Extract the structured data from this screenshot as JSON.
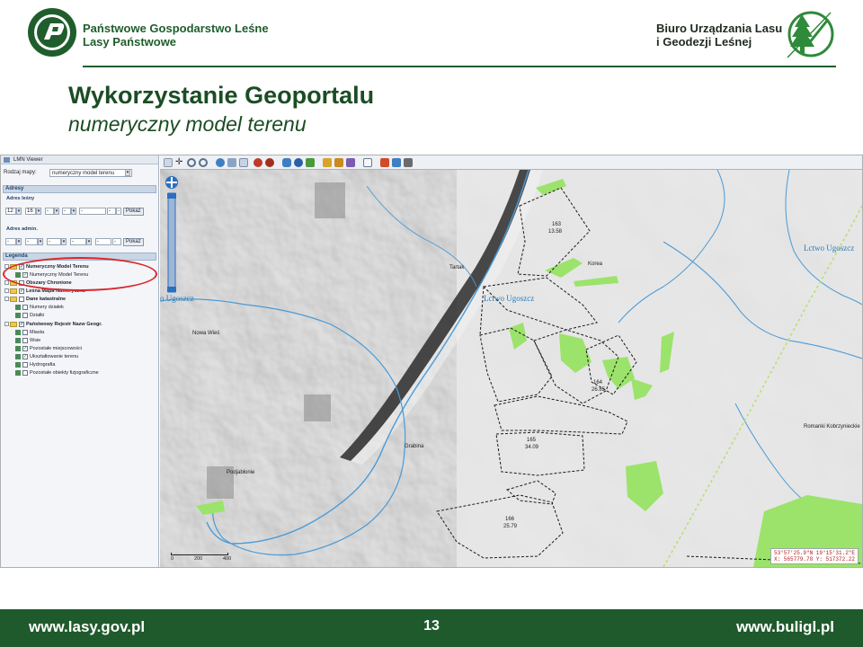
{
  "header": {
    "org_line1": "Państwowe Gospodarstwo Leśne",
    "org_line2": "Lasy Państwowe",
    "biuro_line1": "Biuro Urządzania Lasu",
    "biuro_line2": "i Geodezji Leśnej",
    "logo_left_text": "LASY PAŃSTWOWE"
  },
  "slide": {
    "title": "Wykorzystanie Geoportalu",
    "subtitle": "numeryczny model terenu"
  },
  "viewer": {
    "window_title": "LMN Viewer",
    "map_type_label": "Rodzaj mapy:",
    "map_type_value": "numeryczny model terenu",
    "section_adresy": "Adresy",
    "adres_lesny_label": "Adres leśny",
    "adres_lesny_values": [
      "12",
      "16",
      "-",
      "-",
      "-",
      "-",
      "-"
    ],
    "adres_admin_label": "Adres admin.",
    "admin_values": [
      "-",
      "-",
      "-",
      "-",
      "-",
      "-"
    ],
    "show_button": "Pokaż",
    "section_legenda": "Legenda",
    "legend_items": [
      {
        "label": "Numeryczny Model Terenu",
        "bold": true
      },
      {
        "label": "Numeryczny Model Terenu",
        "bold": false
      },
      {
        "label": "Obszary Chronione",
        "bold": true
      },
      {
        "label": "Leśna Mapa Numeryczna",
        "bold": true
      },
      {
        "label": "Dane katastralne",
        "bold": true
      },
      {
        "label": "Numery działek",
        "bold": false
      },
      {
        "label": "Działki",
        "bold": false
      },
      {
        "label": "Państwowy Rejestr Nazw Geogr.",
        "bold": true
      },
      {
        "label": "Miasta",
        "bold": false
      },
      {
        "label": "Wsie",
        "bold": false
      },
      {
        "label": "Pozostałe miejscowości",
        "bold": false
      },
      {
        "label": "Ukształtowanie terenu",
        "bold": false
      },
      {
        "label": "Hydrografia",
        "bold": false
      },
      {
        "label": "Pozostałe obiekty fizjograficzne",
        "bold": false
      }
    ]
  },
  "map": {
    "labels": {
      "tartak": "Tartak",
      "nowa_wies": "Nowa Wieś",
      "grabina": "Grabina",
      "podjablonie": "Podjabłonie",
      "korea": "Korea",
      "romanki": "Romanki Kobrzyniec­kie",
      "gosz1": "Lctwo Ugoszcz",
      "gosz2": "Lctwo Ugoszcz",
      "gosz3": "o Ugoszcz"
    },
    "compartments": {
      "c163": "163",
      "c163a": "13.58",
      "c164": "164",
      "c164a": "26.85",
      "c165": "165",
      "c165a": "34.09",
      "c166": "166",
      "c166a": "25.79"
    },
    "coords_line1": "53°57'25.9\"N 19°15'31.2\"E",
    "coords_line2": "X: 565779.78 Y: 517372.22",
    "scale_ticks": [
      "0",
      "200",
      "400"
    ]
  },
  "footer": {
    "url_left": "www.lasy.gov.pl",
    "page_number": "13",
    "url_right": "www.buligl.pl"
  },
  "colors": {
    "brand_green": "#1f5a2c",
    "highlight_red": "#d8262c",
    "forest_green": "#9be36a",
    "river_blue": "#4a9ad6"
  }
}
